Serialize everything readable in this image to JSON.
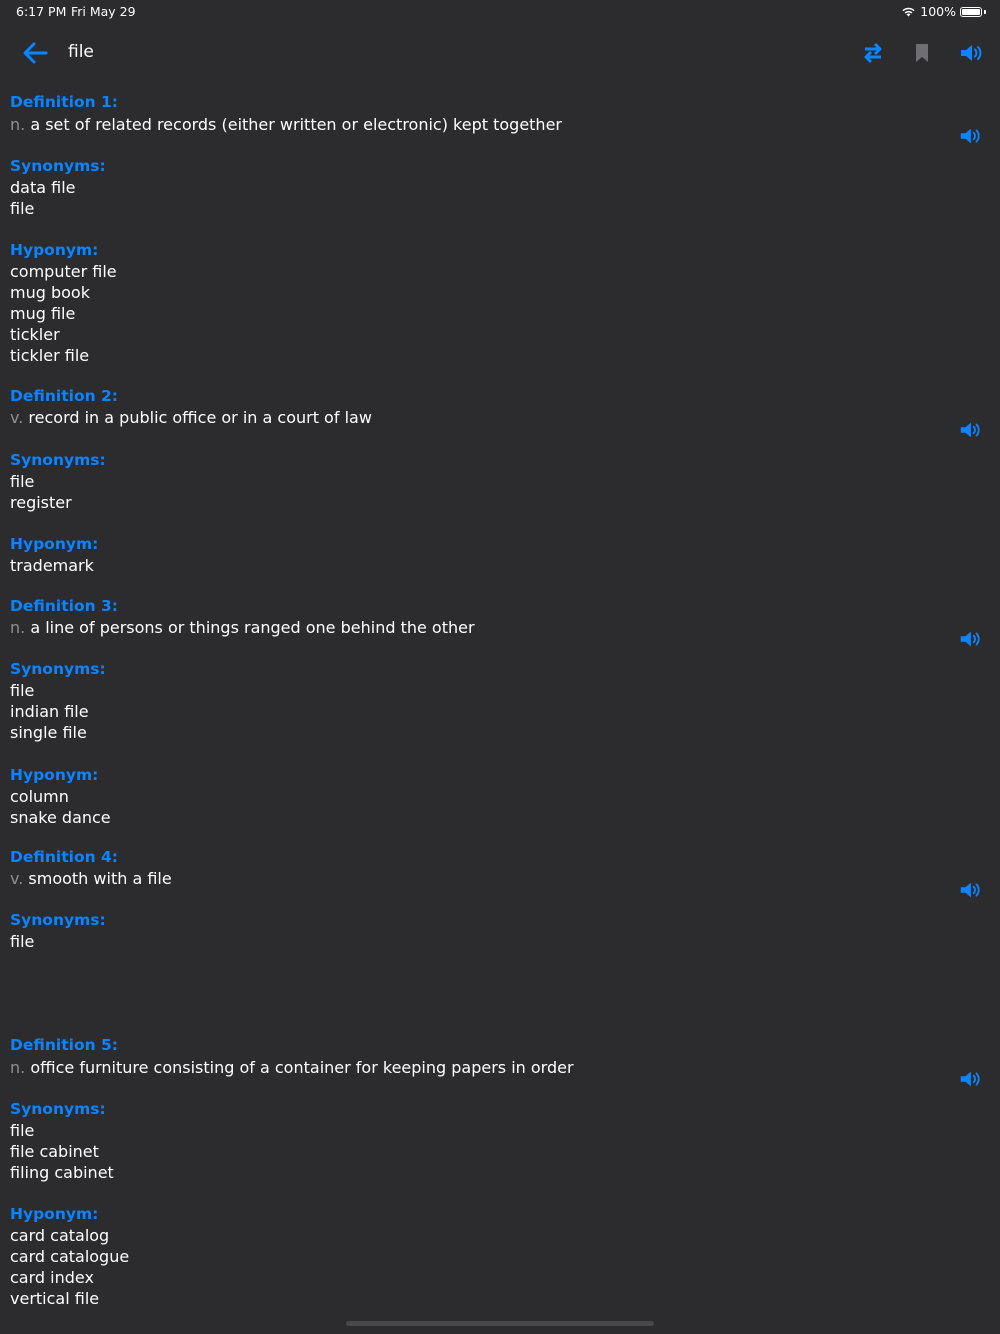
{
  "status_bar": {
    "time": "6:17 PM",
    "date": "Fri May 29",
    "battery": "100%"
  },
  "nav": {
    "word": "file",
    "icons": {
      "back": "arrow-left-icon",
      "swap": "swap-arrows-icon",
      "bookmark": "bookmark-icon",
      "speaker": "speaker-icon"
    }
  },
  "colors": {
    "accent": "#0a84ff",
    "background": "#2c2c2e",
    "pos": "#8e8e93",
    "bookmark": "#6e6e73"
  },
  "definitions": [
    {
      "heading": "Definition 1:",
      "pos": "n.",
      "text": "a set of related records (either written or electronic) kept together",
      "synonyms_label": "Synonyms:",
      "synonyms": [
        "data file",
        "file"
      ],
      "hyponym_label": "Hyponym:",
      "hyponyms": [
        "computer file",
        "mug book",
        "mug file",
        "tickler",
        "tickler file"
      ]
    },
    {
      "heading": "Definition 2:",
      "pos": "v.",
      "text": "record in a public office or in a court of law",
      "synonyms_label": "Synonyms:",
      "synonyms": [
        "file",
        "register"
      ],
      "hyponym_label": "Hyponym:",
      "hyponyms": [
        "trademark"
      ]
    },
    {
      "heading": "Definition 3:",
      "pos": "n.",
      "text": "a line of persons or things ranged one behind the other",
      "synonyms_label": "Synonyms:",
      "synonyms": [
        "file",
        "indian file",
        "single file"
      ],
      "hyponym_label": "Hyponym:",
      "hyponyms": [
        "column",
        "snake dance"
      ]
    },
    {
      "heading": "Definition 4:",
      "pos": "v.",
      "text": "smooth with a file",
      "synonyms_label": "Synonyms:",
      "synonyms": [
        "file"
      ]
    },
    {
      "heading": "Definition 5:",
      "pos": "n.",
      "text": "office furniture consisting of a container for keeping papers in order",
      "synonyms_label": "Synonyms:",
      "synonyms": [
        "file",
        "file cabinet",
        "filing cabinet"
      ],
      "hyponym_label": "Hyponym:",
      "hyponyms": [
        "card catalog",
        "card catalogue",
        "card index",
        "vertical file"
      ]
    }
  ]
}
